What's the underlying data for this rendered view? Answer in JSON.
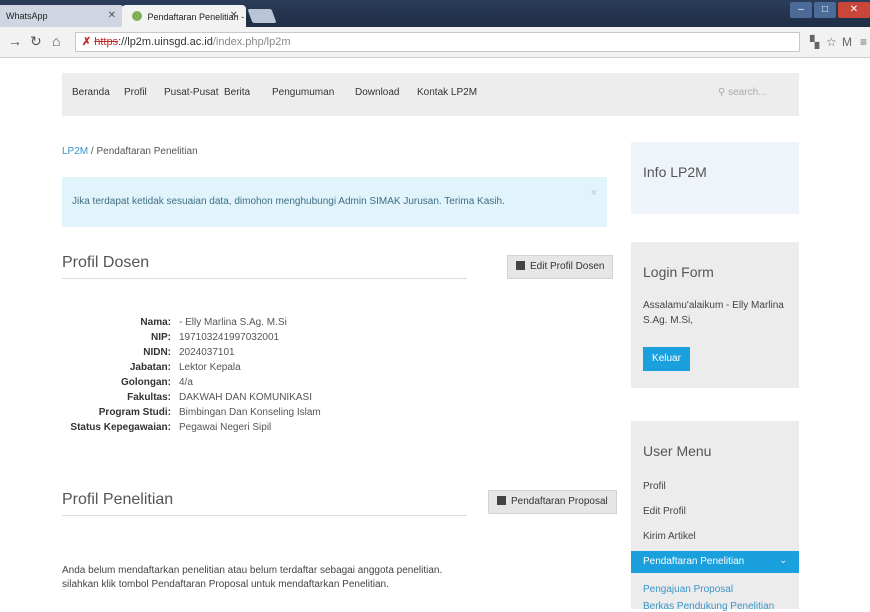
{
  "browser": {
    "tabs": [
      {
        "label": "WhatsApp"
      },
      {
        "label": "Pendaftaran Penelitian - L"
      }
    ],
    "url": {
      "scheme": "https",
      "rest": "://lp2m.uinsgd.ac.id",
      "path": "/index.php/lp2m"
    }
  },
  "navbar": {
    "items": [
      "Beranda",
      "Profil",
      "Pusat-Pusat",
      "Berita",
      "Pengumuman",
      "Download",
      "Kontak LP2M"
    ],
    "search_placeholder": "search..."
  },
  "breadcrumb": {
    "home": "LP2M",
    "separator": "/",
    "current": "Pendaftaran Penelitian"
  },
  "alert": {
    "text": "Jika terdapat ketidak sesuaian data, dimohon menghubungi Admin SIMAK Jurusan. Terima Kasih.",
    "close": "×"
  },
  "profil_dosen": {
    "title": "Profil Dosen",
    "edit_button": "Edit Profil Dosen",
    "rows": [
      {
        "label": "Nama:",
        "value": "- Elly Marlina S.Ag. M.Si"
      },
      {
        "label": "NIP:",
        "value": "197103241997032001"
      },
      {
        "label": "NIDN:",
        "value": "2024037101"
      },
      {
        "label": "Jabatan:",
        "value": "Lektor Kepala"
      },
      {
        "label": "Golongan:",
        "value": "4/a"
      },
      {
        "label": "Fakultas:",
        "value": "DAKWAH DAN KOMUNIKASI"
      },
      {
        "label": "Program Studi:",
        "value": "Bimbingan Dan Konseling Islam"
      },
      {
        "label": "Status Kepegawaian:",
        "value": "Pegawai Negeri Sipil"
      }
    ]
  },
  "profil_penelitian": {
    "title": "Profil Penelitian",
    "button": "Pendaftaran Proposal",
    "line1": "Anda belum mendaftarkan penelitian atau belum terdaftar sebagai anggota penelitian.",
    "line2": "silahkan klik tombol Pendaftaran Proposal untuk mendaftarkan Penelitian."
  },
  "sidebar": {
    "info_title": "Info LP2M",
    "login_title": "Login Form",
    "greeting": "Assalamu'alaikum - Elly Marlina S.Ag. M.Si,",
    "logout_button": "Keluar",
    "user_menu_title": "User Menu",
    "menu_items": [
      "Profil",
      "Edit Profil",
      "Kirim Artikel"
    ],
    "active_item": "Pendaftaran Penelitian",
    "submenu": [
      "Pengajuan Proposal",
      "Berkas Pendukung Penelitian"
    ]
  },
  "colors": {
    "accent": "#1aa0dc",
    "link": "#3a95c9",
    "alert_bg": "#e1f3fb"
  }
}
